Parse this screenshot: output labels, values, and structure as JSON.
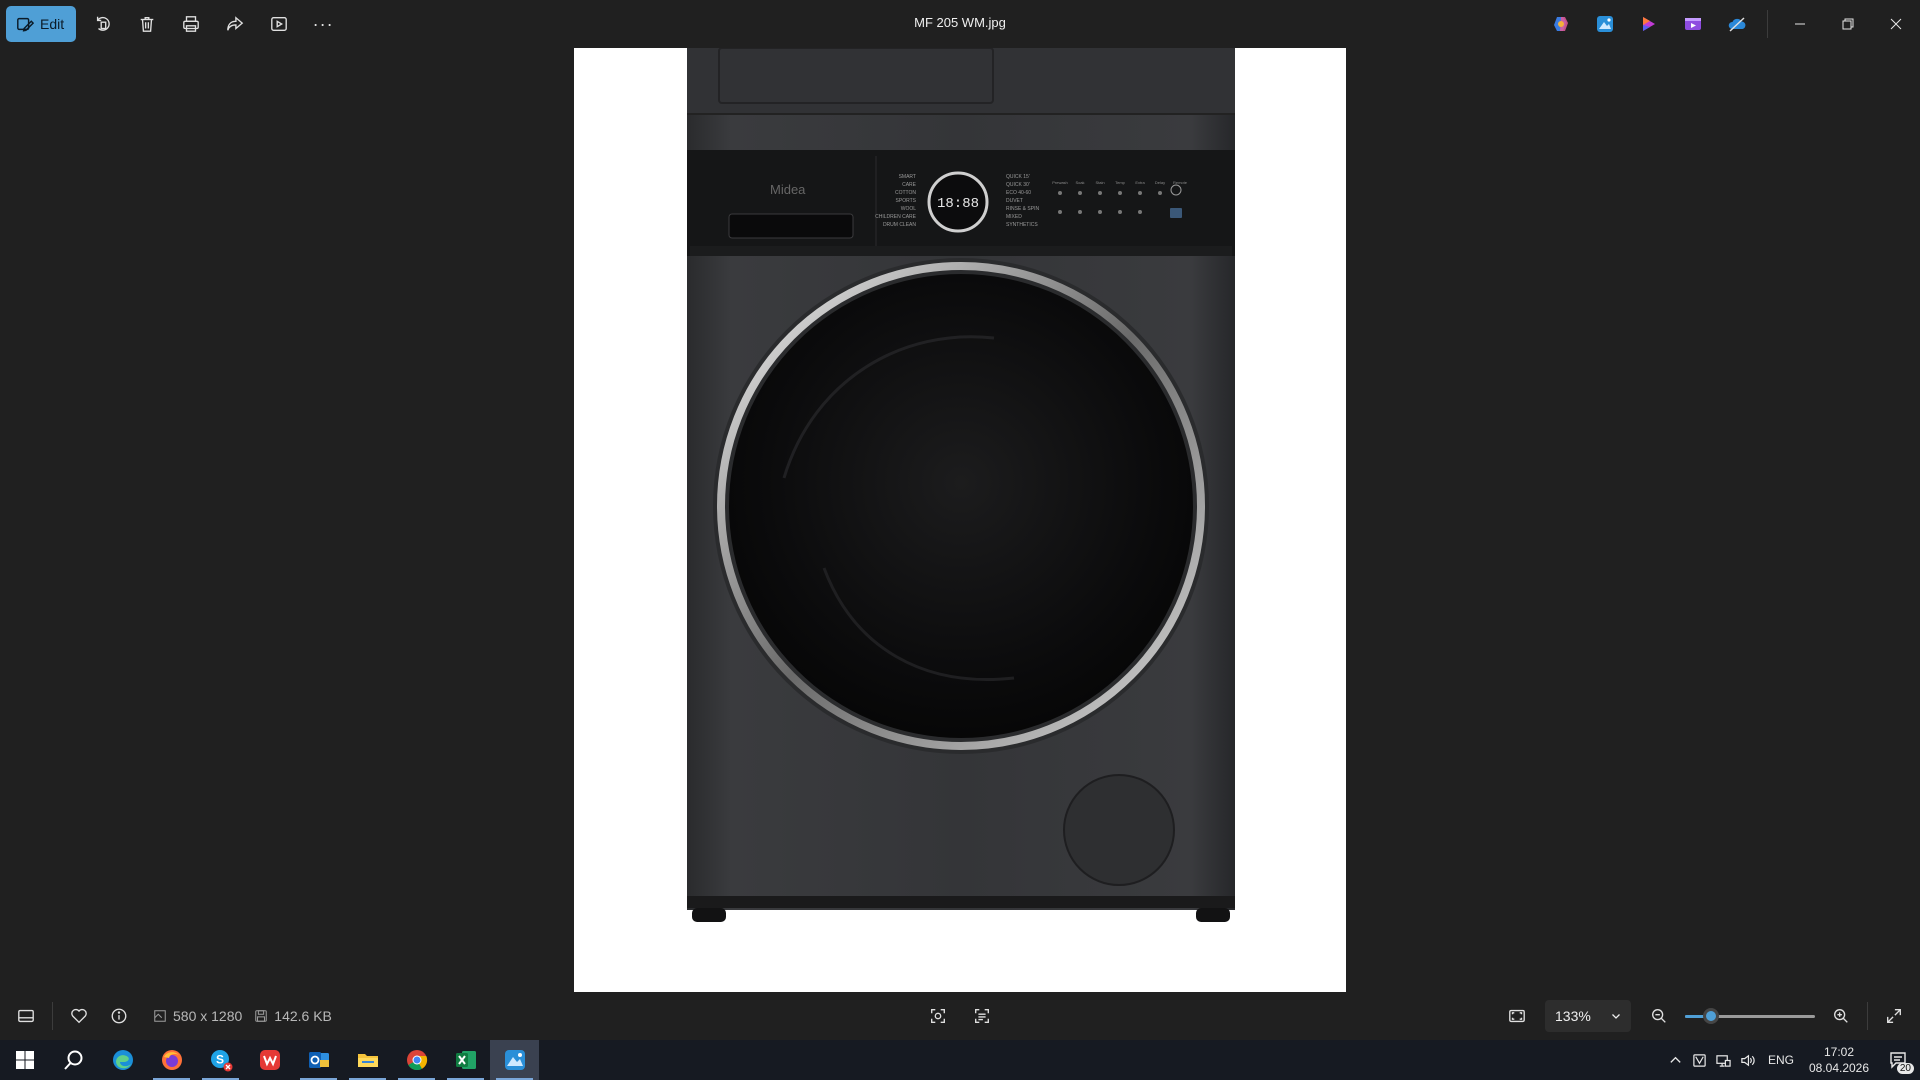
{
  "window": {
    "title": "MF 205 WM.jpg"
  },
  "toolbar": {
    "edit_label": "Edit",
    "icons": [
      "rotate-icon",
      "delete-icon",
      "print-icon",
      "share-icon",
      "slideshow-icon",
      "more-icon"
    ],
    "more_glyph": "···"
  },
  "titlebar_apps": [
    "copilot-icon",
    "photos-icon",
    "clipchamp-icon",
    "media-icon",
    "onedrive-icon"
  ],
  "image": {
    "brand": "Midea",
    "display_digits": "18:88",
    "panel_lines_left": [
      "SMART",
      "CARE",
      "COTTON",
      "SPORTS",
      "WOOL",
      "CHILDREN CARE",
      "DRUM CLEAN"
    ],
    "panel_lines_right": [
      "QUICK 15'",
      "QUICK 30'",
      "ECO 40-60",
      "DUVET",
      "RINSE & SPIN",
      "MIXED",
      "SYNTHETICS"
    ],
    "option_labels": [
      "Prewash",
      "Soak",
      "Stain",
      "Temp",
      "Extra",
      "Delay",
      "Remote"
    ]
  },
  "bottombar": {
    "dimensions": "580 x 1280",
    "filesize": "142.6 KB",
    "zoom_label": "133%",
    "zoom_fraction": 0.2
  },
  "taskbar": {
    "apps": [
      "windows-start-icon",
      "search-icon",
      "edge-icon",
      "firefox-icon",
      "skype-icon",
      "wps-office-icon",
      "outlook-icon",
      "file-explorer-icon",
      "chrome-icon",
      "excel-icon",
      "photos-app-icon"
    ],
    "language": "ENG",
    "time": "17:02",
    "date": "08.04.2026",
    "notification_count": "20"
  },
  "colors": {
    "accent": "#4f9fd6",
    "background": "#202020",
    "taskbar": "#161a22"
  }
}
